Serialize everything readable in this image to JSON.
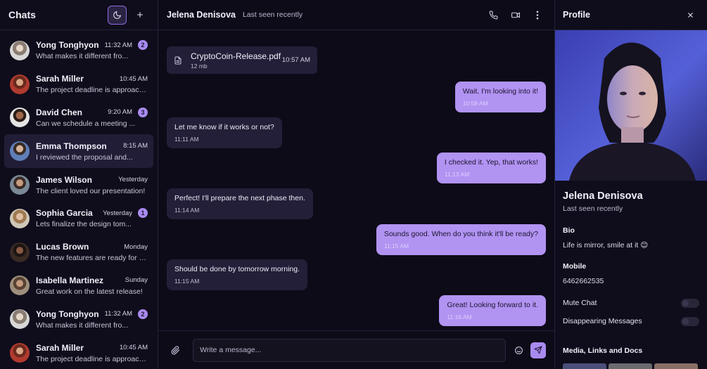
{
  "sidebar": {
    "title": "Chats",
    "chats": [
      {
        "name": "Yong Tonghyon",
        "time": "11:32 AM",
        "preview": "What makes it different fro...",
        "badge": "2"
      },
      {
        "name": "Sarah Miller",
        "time": "10:45 AM",
        "preview": "The project deadline is approachi...",
        "badge": ""
      },
      {
        "name": "David Chen",
        "time": "9:20 AM",
        "preview": "Can we schedule a meeting ...",
        "badge": "3"
      },
      {
        "name": "Emma Thompson",
        "time": "8:15 AM",
        "preview": "I reviewed the proposal and...",
        "badge": ""
      },
      {
        "name": "James Wilson",
        "time": "Yesterday",
        "preview": "The client loved our presentation!",
        "badge": ""
      },
      {
        "name": "Sophia Garcia",
        "time": "Yesterday",
        "preview": "Lets finalize the design tom...",
        "badge": "1"
      },
      {
        "name": "Lucas Brown",
        "time": "Monday",
        "preview": "The new features are ready for te...",
        "badge": ""
      },
      {
        "name": "Isabella Martinez",
        "time": "Sunday",
        "preview": "Great work on the latest release!",
        "badge": ""
      },
      {
        "name": "Yong Tonghyon",
        "time": "11:32 AM",
        "preview": "What makes it different fro...",
        "badge": "2"
      },
      {
        "name": "Sarah Miller",
        "time": "10:45 AM",
        "preview": "The project deadline is approachi...",
        "badge": ""
      }
    ]
  },
  "conversation": {
    "contact_name": "Jelena Denisova",
    "contact_status": "Last seen recently",
    "file": {
      "name": "CryptoCoin-Release.pdf",
      "size": "12 mb",
      "time": "10:57 AM"
    },
    "messages": [
      {
        "dir": "out",
        "text": "Wait. I'm looking into it!",
        "time": "10:58 AM"
      },
      {
        "dir": "in",
        "text": "Let me know if it works or not?",
        "time": "11:11 AM"
      },
      {
        "dir": "out",
        "text": "I checked it. Yep, that works!",
        "time": "11:13 AM"
      },
      {
        "dir": "in",
        "text": "Perfect! I'll prepare the next phase then.",
        "time": "11:14 AM"
      },
      {
        "dir": "out",
        "text": "Sounds good. When do you think it'll be ready?",
        "time": "11:15 AM"
      },
      {
        "dir": "in",
        "text": "Should be done by tomorrow morning.",
        "time": "11:15 AM"
      },
      {
        "dir": "out",
        "text": "Great! Looking forward to it.",
        "time": "11:16 AM"
      }
    ],
    "composer_placeholder": "Write a message..."
  },
  "profile": {
    "title": "Profile",
    "name": "Jelena Denisova",
    "status": "Last seen recently",
    "bio_label": "Bio",
    "bio": "Life is mirror, smile at it 😊",
    "mobile_label": "Mobile",
    "mobile": "6462662535",
    "mute_label": "Mute Chat",
    "mute_on": false,
    "disappearing_label": "Disappearing Messages",
    "disappearing_on": false,
    "media_label": "Media, Links and Docs"
  },
  "colors": {
    "accent": "#a98bf0",
    "outgoing_bubble": "#b193f2",
    "incoming_bubble": "#231f38",
    "background": "#0d0b18"
  }
}
